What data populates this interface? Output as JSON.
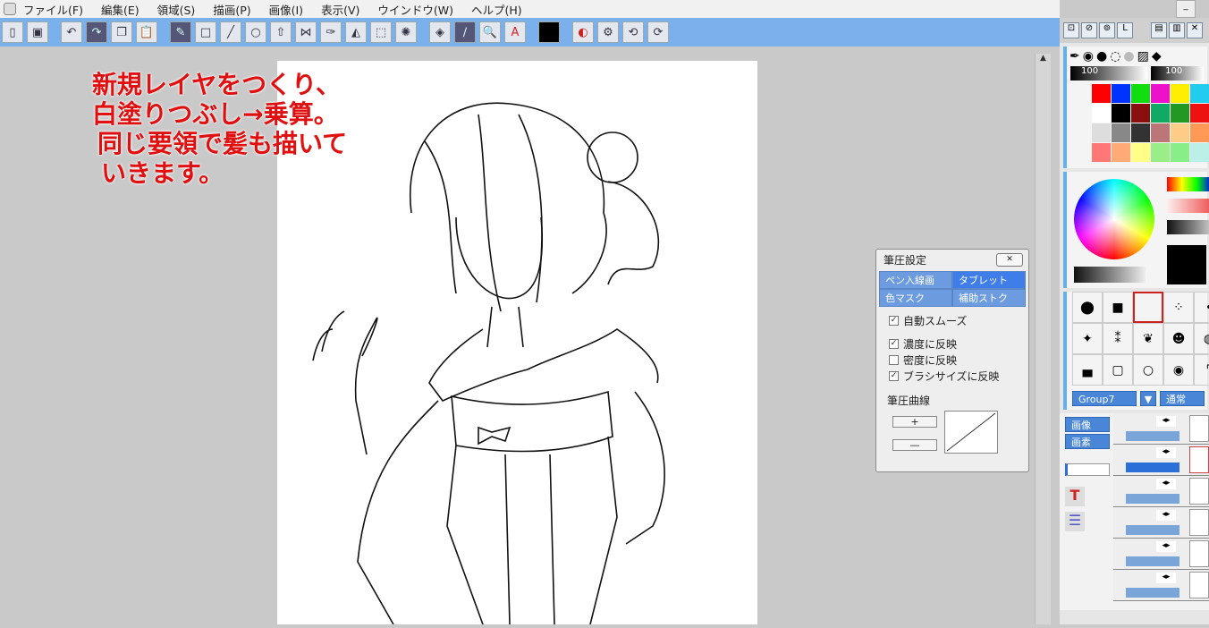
{
  "menu": [
    "ファイル(F)",
    "編集(E)",
    "領域(S)",
    "描画(P)",
    "画像(I)",
    "表示(V)",
    "ウインドウ(W)",
    "ヘルプ(H)"
  ],
  "annotation": [
    "新規レイヤをつくり、",
    "白塗りつぶし→乗算。",
    "同じ要領で髪も描いて",
    "いきます。"
  ],
  "dialog": {
    "title": "筆圧設定",
    "close": "✕",
    "tabs": [
      "ペン入線画",
      "タブレット",
      "色マスク",
      "補助ストク"
    ],
    "auto_smooth": {
      "label": "自動スムーズ",
      "checked": true
    },
    "options": [
      {
        "label": "濃度に反映",
        "checked": true
      },
      {
        "label": "密度に反映",
        "checked": false
      },
      {
        "label": "ブラシサイズに反映",
        "checked": true
      }
    ],
    "curve_label": "筆圧曲線",
    "plus": "+",
    "minus": "—"
  },
  "right_panel": {
    "size_value": "100",
    "opacity_value": "100",
    "palette": [
      "#ff0000",
      "#0033ff",
      "#11dd11",
      "#ee11cc",
      "#ffee00",
      "#22ccee",
      "#ffffff",
      "#000000",
      "#8a1010",
      "#10aa66",
      "#229922",
      "#ee1111",
      "#dddddd",
      "#888888",
      "#333333",
      "#bb7777",
      "#ffcc88",
      "#ff9955",
      "#ff7777",
      "#ffaa77",
      "#ffff88",
      "#99ee88",
      "#88ee88",
      "#bbf0e8"
    ],
    "brush_group": "Group7",
    "blend": "通常",
    "layer_buttons": [
      "画像",
      "画素"
    ]
  }
}
